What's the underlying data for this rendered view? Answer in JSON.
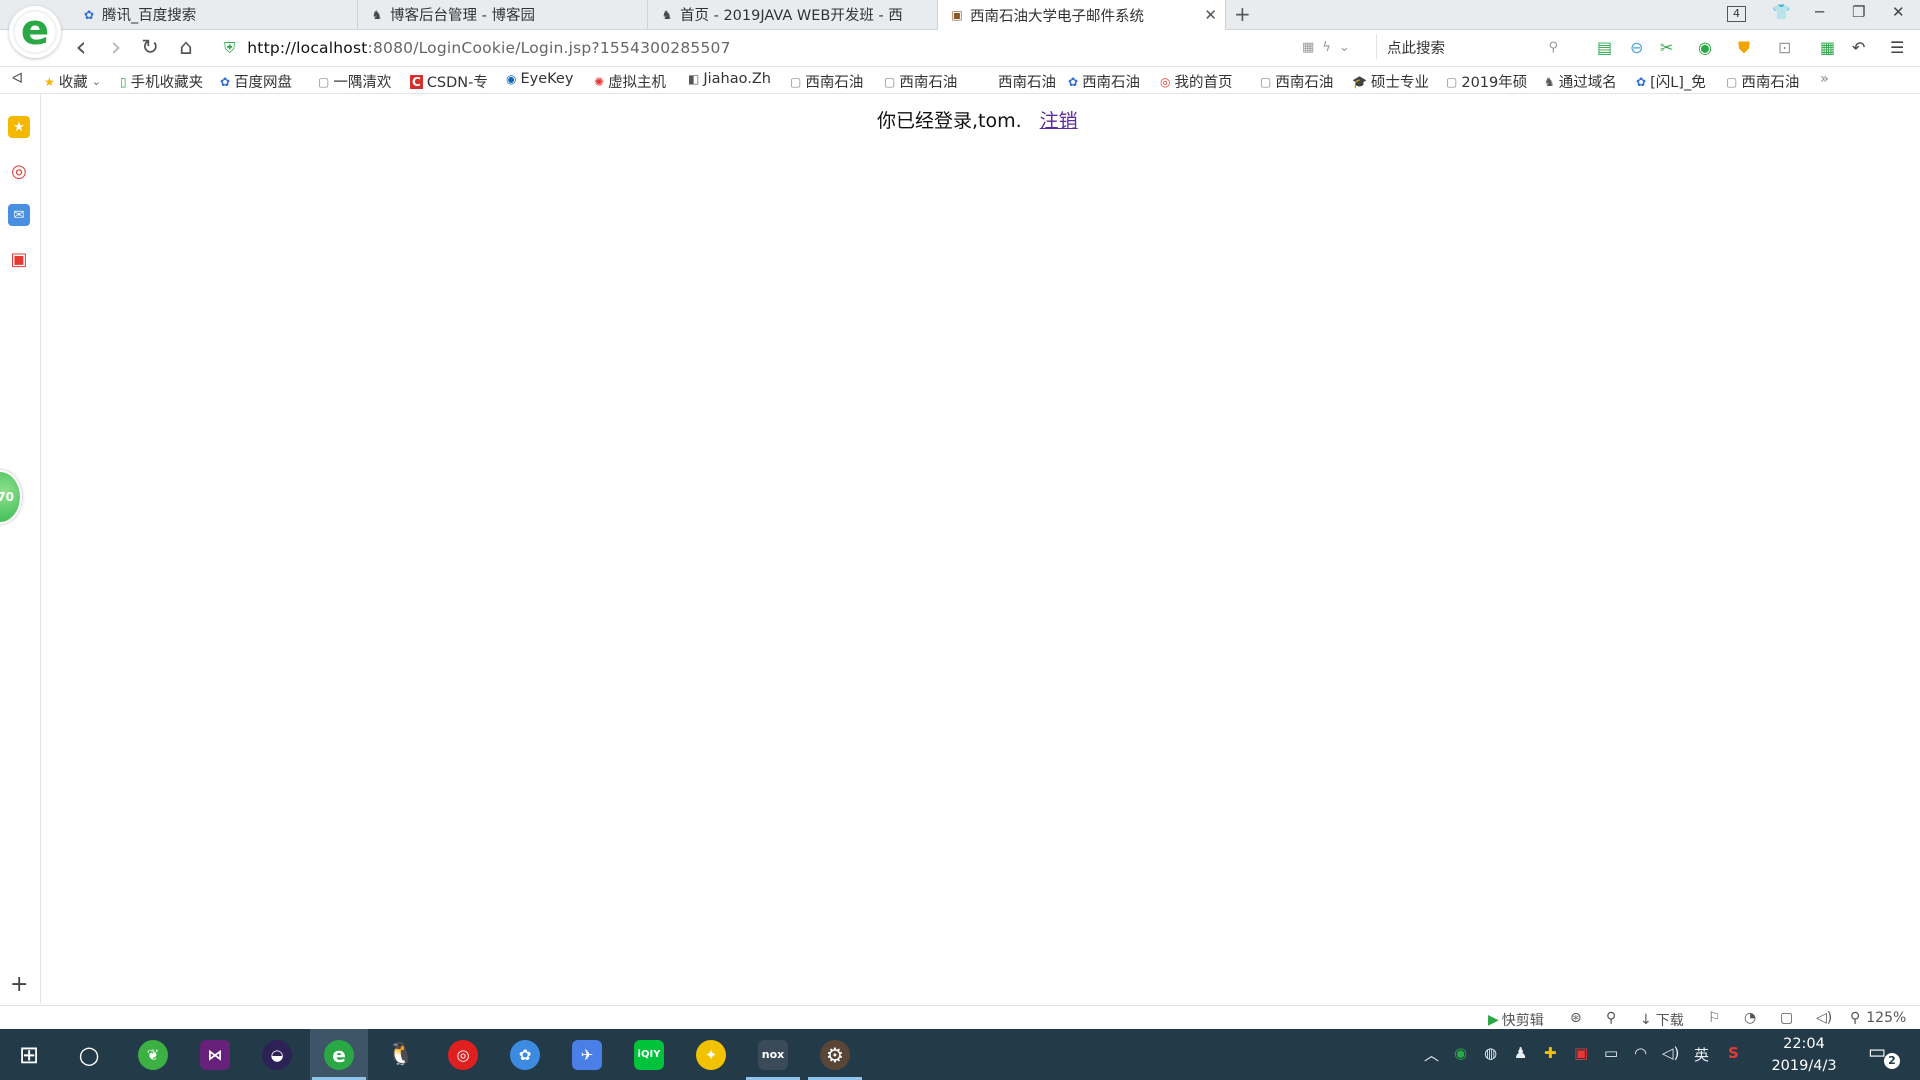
{
  "browser": {
    "logo_letter": "e",
    "tabs": [
      {
        "title": "腾讯_百度搜索",
        "icon": "✿"
      },
      {
        "title": "博客后台管理 - 博客园",
        "icon": "♞"
      },
      {
        "title": "首页 - 2019JAVA WEB开发班 - 西",
        "icon": "♞"
      },
      {
        "title": "西南石油大学电子邮件系统",
        "icon": "▣"
      }
    ],
    "new_tab": "+",
    "tab_count": "4",
    "window_controls": {
      "skin": "👕",
      "minimize": "─",
      "restore": "❐",
      "close": "✕"
    },
    "url_host": "http://localhost",
    "url_rest": ":8080/LoginCookie/Login.jsp?1554300285507",
    "search_placeholder": "点此搜索",
    "nav": {
      "back": "‹",
      "forward": "›",
      "refresh": "↻",
      "home": "⌂"
    }
  },
  "bookmarks": [
    {
      "label": "收藏",
      "icon": "★",
      "color": "#f4b400"
    },
    {
      "label": "手机收藏夹",
      "icon": "▯",
      "color": "#2aa845"
    },
    {
      "label": "百度网盘",
      "icon": "✿",
      "color": "#2f6fd6"
    },
    {
      "label": "一隅清欢",
      "icon": "▢",
      "color": "#888888"
    },
    {
      "label": "CSDN-专",
      "icon": "C",
      "color": "#d32f2f"
    },
    {
      "label": "EyeKey",
      "icon": "◉",
      "color": "#1565c0"
    },
    {
      "label": "虚拟主机",
      "icon": "✺",
      "color": "#e53935"
    },
    {
      "label": "Jiahao.Zh",
      "icon": "◧",
      "color": "#555555"
    },
    {
      "label": "西南石油",
      "icon": "▢",
      "color": "#888888"
    },
    {
      "label": "西南石油",
      "icon": "▢",
      "color": "#888888"
    },
    {
      "label": "西南石油",
      "icon": "",
      "color": "#888888"
    },
    {
      "label": "西南石油",
      "icon": "✿",
      "color": "#2f6fd6"
    },
    {
      "label": "我的首页",
      "icon": "◎",
      "color": "#e53935"
    },
    {
      "label": "西南石油",
      "icon": "▢",
      "color": "#888888"
    },
    {
      "label": "硕士专业",
      "icon": "🎓",
      "color": "#222222"
    },
    {
      "label": "2019年硕",
      "icon": "▢",
      "color": "#888888"
    },
    {
      "label": "通过域名",
      "icon": "♞",
      "color": "#555555"
    },
    {
      "label": "[闪L]_免",
      "icon": "✿",
      "color": "#2f6fd6"
    },
    {
      "label": "西南石油",
      "icon": "▢",
      "color": "#888888"
    }
  ],
  "bookmarks_more": "»",
  "page": {
    "message": "你已经登录,tom.",
    "logout_link": "注销"
  },
  "floating_badge": "70",
  "statusbar": {
    "quick_cut": "快剪辑",
    "download": "下载",
    "zoom": "125%"
  },
  "taskbar": {
    "apps": [
      {
        "name": "start",
        "glyph": "⊞",
        "color": "transparent"
      },
      {
        "name": "cortana",
        "glyph": "○",
        "color": "transparent"
      },
      {
        "name": "green-app",
        "glyph": "❦",
        "color": "#3cb043"
      },
      {
        "name": "visual-studio",
        "glyph": "⋈",
        "color": "#68217a"
      },
      {
        "name": "eclipse",
        "glyph": "◒",
        "color": "#2c2255"
      },
      {
        "name": "360-browser",
        "glyph": "e",
        "color": "#2aa845"
      },
      {
        "name": "qq",
        "glyph": "🐧",
        "color": "transparent"
      },
      {
        "name": "netease-music",
        "glyph": "◎",
        "color": "#e02020"
      },
      {
        "name": "browser-blue",
        "glyph": "✿",
        "color": "#3d8be0"
      },
      {
        "name": "feishu",
        "glyph": "✈",
        "color": "#4a7fe8"
      },
      {
        "name": "iqiyi",
        "glyph": "iQIY",
        "color": "#00c23b"
      },
      {
        "name": "yellow-app",
        "glyph": "✦",
        "color": "#f2c200"
      },
      {
        "name": "nox",
        "glyph": "nox",
        "color": "#3a4a58"
      },
      {
        "name": "gear-app",
        "glyph": "⚙",
        "color": "#5a4636"
      }
    ],
    "ime": "英",
    "time": "22:04",
    "date": "2019/4/3",
    "notifications": "2"
  }
}
